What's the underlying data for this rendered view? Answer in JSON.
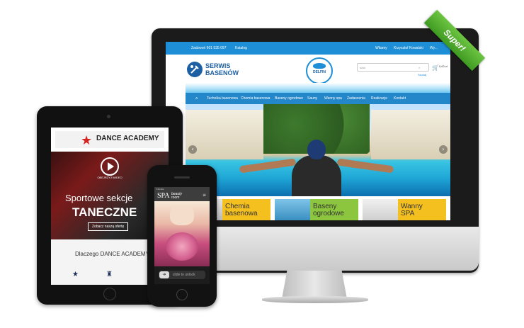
{
  "ribbon": {
    "label": "Super!"
  },
  "desktop": {
    "topbar": {
      "phone": "Zadzwoń 601 535 097",
      "catalog": "Katalog",
      "welcome": "Witamy",
      "user": "Krzysztof Kowalski",
      "logout": "Wy..."
    },
    "logo": {
      "line1": "SERWIS",
      "line2": "BASENÓW"
    },
    "brand": {
      "name": "DELFIN"
    },
    "search": {
      "placeholder": "szuk",
      "button": "Szukaj"
    },
    "cart": {
      "count": "0",
      "total": "0,00 zł"
    },
    "nav": [
      "Technika basenowa",
      "Chemia basenowa",
      "Baseny ogrodowe",
      "Sauny",
      "Wanny spa",
      "Zadaszenia",
      "Realizacje",
      "Kontakt"
    ],
    "tiles": [
      {
        "line1": "Chemia",
        "line2": "basenowa"
      },
      {
        "line1": "Baseny",
        "line2": "ogrodowe"
      },
      {
        "line1": "Wanny",
        "line2": "SPA"
      }
    ]
  },
  "tablet": {
    "brand": "DANCE ACADEMY",
    "video_label": "OBEJRZYJ WIDEO",
    "headline1": "Sportowe sekcje",
    "headline2": "TANECZNE",
    "cta": "Zobacz naszą ofertę",
    "section_title": "Dlaczego DANCE ACADEMY"
  },
  "phone": {
    "status_left": "T-Mobile",
    "brand": "SPA",
    "brand_sub": "beauty room",
    "unlock": "slide to unlock"
  },
  "colors": {
    "accent_blue": "#1e8fd6",
    "ribbon_green": "#5cb335",
    "tile_yellow": "#f4c01f",
    "tile_green": "#8cc63f",
    "tile_gray": "#d8d8d8"
  }
}
